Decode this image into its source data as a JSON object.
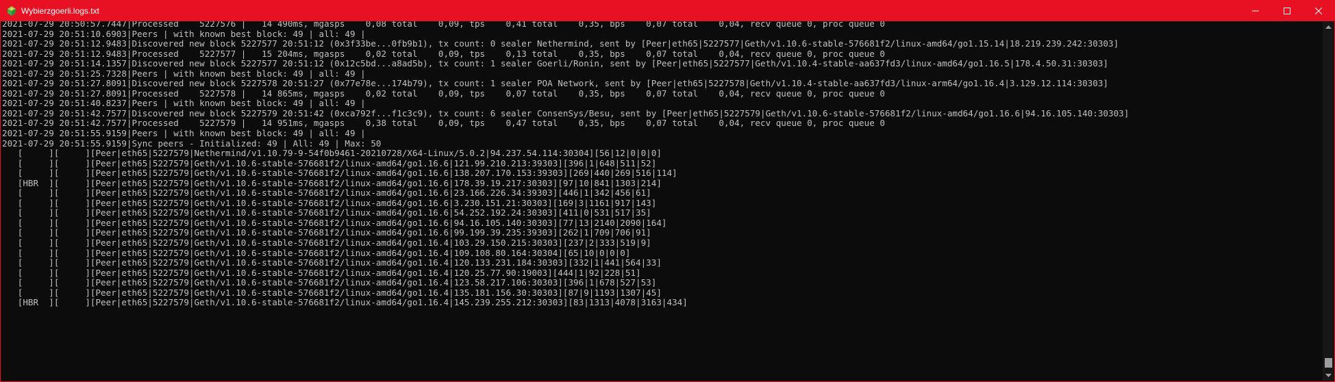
{
  "window": {
    "title": "Wybierzgoerli.logs.txt",
    "icon": "gem-icon",
    "accent_color": "#e81123",
    "text_color": "#c0c0c0",
    "background_color": "#0c0c0c"
  },
  "lines": [
    "2021-07-29 20:50:57.7447|Processed    5227576 |   14 490ms, mgasps    0,08 total    0,09, tps    0,41 total    0,35, bps    0,07 total    0,04, recv queue 0, proc queue 0",
    "2021-07-29 20:51:10.6903|Peers | with known best block: 49 | all: 49 |",
    "2021-07-29 20:51:12.9483|Discovered new block 5227577 20:51:12 (0x3f33be...0fb9b1), tx count: 0 sealer Nethermind, sent by [Peer|eth65|5227577|Geth/v1.10.6-stable-576681f2/linux-amd64/go1.15.14|18.219.239.242:30303]",
    "2021-07-29 20:51:12.9483|Processed    5227577 |   15 204ms, mgasps    0,02 total    0,09, tps    0,13 total    0,35, bps    0,07 total    0,04, recv queue 0, proc queue 0",
    "2021-07-29 20:51:14.1357|Discovered new block 5227577 20:51:12 (0x12c5bd...a8ad5b), tx count: 1 sealer Goerli/Ronin, sent by [Peer|eth65|5227577|Geth/v1.10.4-stable-aa637fd3/linux-amd64/go1.16.5|178.4.50.31:30303]",
    "2021-07-29 20:51:25.7328|Peers | with known best block: 49 | all: 49 |",
    "2021-07-29 20:51:27.8091|Discovered new block 5227578 20:51:27 (0x77e78e...174b79), tx count: 1 sealer POA Network, sent by [Peer|eth65|5227578|Geth/v1.10.4-stable-aa637fd3/linux-arm64/go1.16.4|3.129.12.114:30303]",
    "2021-07-29 20:51:27.8091|Processed    5227578 |   14 865ms, mgasps    0,02 total    0,09, tps    0,07 total    0,35, bps    0,07 total    0,04, recv queue 0, proc queue 0",
    "2021-07-29 20:51:40.8237|Peers | with known best block: 49 | all: 49 |",
    "2021-07-29 20:51:42.7577|Discovered new block 5227579 20:51:42 (0xca792f...f1c3c9), tx count: 6 sealer ConsenSys/Besu, sent by [Peer|eth65|5227579|Geth/v1.10.6-stable-576681f2/linux-amd64/go1.16.6|94.16.105.140:30303]",
    "2021-07-29 20:51:42.7577|Processed    5227579 |   14 951ms, mgasps    0,38 total    0,09, tps    0,47 total    0,35, bps    0,07 total    0,04, recv queue 0, proc queue 0",
    "2021-07-29 20:51:55.9159|Peers | with known best block: 49 | all: 49 |",
    "2021-07-29 20:51:55.9159|Sync peers - Initialized: 49 | All: 49 | Max: 50",
    "   [     ][     ][Peer|eth65|5227579|Nethermind/v1.10.79-9-54f0b9461-20210728/X64-Linux/5.0.2|94.237.54.114:30304][56|12|0|0|0]",
    "   [     ][     ][Peer|eth65|5227579|Geth/v1.10.6-stable-576681f2/linux-amd64/go1.16.6|121.99.210.213:39303][396|1|648|511|52]",
    "   [     ][     ][Peer|eth65|5227579|Geth/v1.10.6-stable-576681f2/linux-amd64/go1.16.6|138.207.170.153:39303][269|440|269|516|114]",
    "   [HBR  ][     ][Peer|eth65|5227579|Geth/v1.10.6-stable-576681f2/linux-amd64/go1.16.6|178.39.19.217:30303][97|10|841|1303|214]",
    "   [     ][     ][Peer|eth65|5227579|Geth/v1.10.6-stable-576681f2/linux-amd64/go1.16.6|23.166.226.34:39303][446|1|342|456|61]",
    "   [     ][     ][Peer|eth65|5227579|Geth/v1.10.6-stable-576681f2/linux-amd64/go1.16.6|3.230.151.21:30303][169|3|1161|917|143]",
    "   [     ][     ][Peer|eth65|5227579|Geth/v1.10.6-stable-576681f2/linux-amd64/go1.16.6|54.252.192.24:30303][411|0|531|517|35]",
    "   [     ][     ][Peer|eth65|5227579|Geth/v1.10.6-stable-576681f2/linux-amd64/go1.16.6|94.16.105.140:30303][77|13|2140|2090|164]",
    "   [     ][     ][Peer|eth65|5227579|Geth/v1.10.6-stable-576681f2/linux-amd64/go1.16.6|99.199.39.235:39303][262|1|709|706|91]",
    "   [     ][     ][Peer|eth65|5227579|Geth/v1.10.6-stable-576681f2/linux-amd64/go1.16.4|103.29.150.215:30303][237|2|333|519|9]",
    "   [     ][     ][Peer|eth65|5227579|Geth/v1.10.6-stable-576681f2/linux-amd64/go1.16.4|109.108.80.164:30304][65|10|0|0|0]",
    "   [     ][     ][Peer|eth65|5227579|Geth/v1.10.6-stable-576681f2/linux-amd64/go1.16.4|120.133.231.184:30303][332|1|441|564|33]",
    "   [     ][     ][Peer|eth65|5227579|Geth/v1.10.6-stable-576681f2/linux-amd64/go1.16.4|120.25.77.90:19003][444|1|92|228|51]",
    "   [     ][     ][Peer|eth65|5227579|Geth/v1.10.6-stable-576681f2/linux-amd64/go1.16.4|123.58.217.106:30303][396|1|678|527|53]",
    "   [     ][     ][Peer|eth65|5227579|Geth/v1.10.6-stable-576681f2/linux-amd64/go1.16.4|135.181.156.30:30303][87|9|1193|1307|45]",
    "   [HBR  ][     ][Peer|eth65|5227579|Geth/v1.10.6-stable-576681f2/linux-amd64/go1.16.4|145.239.255.212:30303][83|1313|4078|3163|434]"
  ]
}
